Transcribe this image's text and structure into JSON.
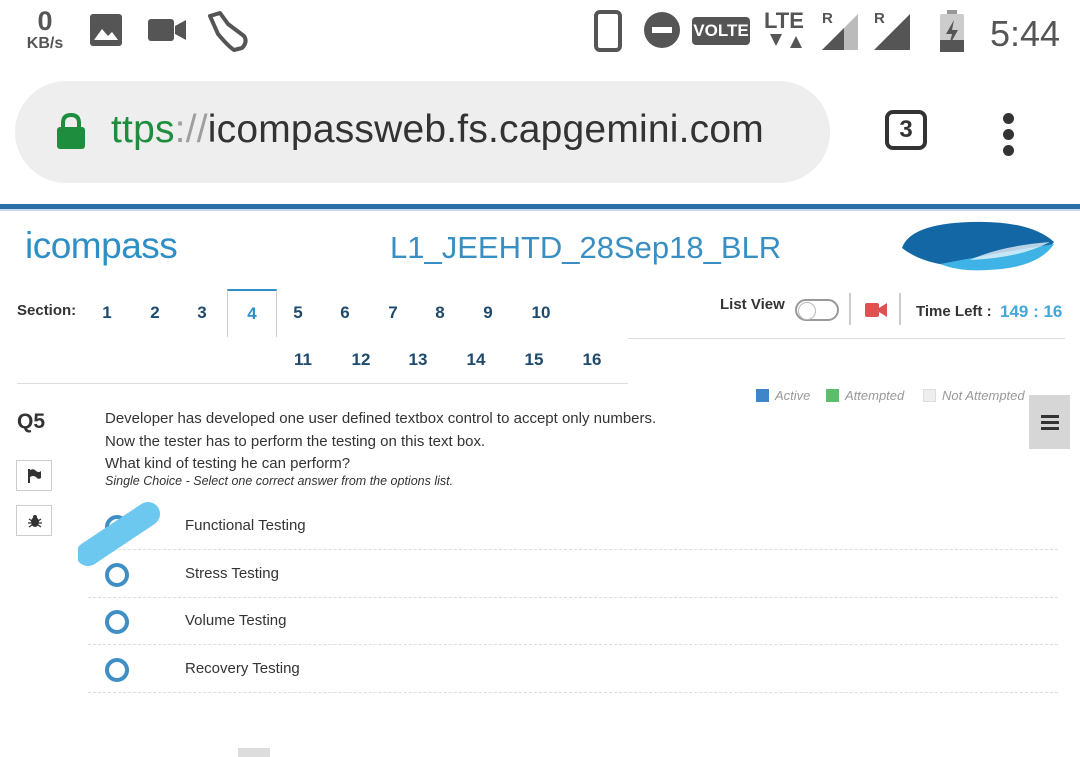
{
  "status_bar": {
    "speed_value": "0",
    "speed_unit": "KB/s",
    "volte": "VOLTE",
    "lte": "LTE",
    "roaming_1": "R",
    "roaming_2": "R",
    "time": "5:44",
    "icons": [
      "gallery-icon",
      "video-icon",
      "shoe-icon",
      "phone-icon",
      "dnd-icon",
      "signal-icon",
      "battery-icon"
    ]
  },
  "browser": {
    "url_scheme": "ttps",
    "url_separator": "://",
    "url_host": "icompassweb.fs.capgemini.com",
    "tab_count": "3"
  },
  "header": {
    "logo_text": "icompass",
    "title": "L1_JEEHTD_28Sep18_BLR"
  },
  "sections": {
    "label": "Section:",
    "items": [
      "1",
      "2",
      "3",
      "4",
      "5",
      "6",
      "7",
      "8",
      "9",
      "10",
      "11",
      "12",
      "13",
      "14",
      "15",
      "16"
    ],
    "active": "4"
  },
  "controls": {
    "list_view_label": "List View",
    "list_view_on": false,
    "time_left_label": "Time Left :",
    "time_left_value": "149 : 16"
  },
  "legend": {
    "active": "Active",
    "attempted": "Attempted",
    "not_attempted": "Not Attempted",
    "colors": {
      "active": "#3f86c8",
      "attempted": "#5cbd6a",
      "not_attempted": "#eeeeee"
    }
  },
  "question": {
    "number": "Q5",
    "lines": [
      "Developer has developed one user defined textbox control to accept only numbers.",
      "Now the tester has to perform the testing on this text box.",
      "What kind of testing he can perform?"
    ],
    "hint": "Single Choice - Select one correct answer from the options list.",
    "options": [
      "Functional Testing",
      "Stress Testing",
      "Volume Testing",
      "Recovery Testing"
    ]
  },
  "theme": {
    "accent": "#2e8fc6",
    "radio": "#3f8fc4",
    "timer": "#45a6d8",
    "camera": "#e05252"
  }
}
